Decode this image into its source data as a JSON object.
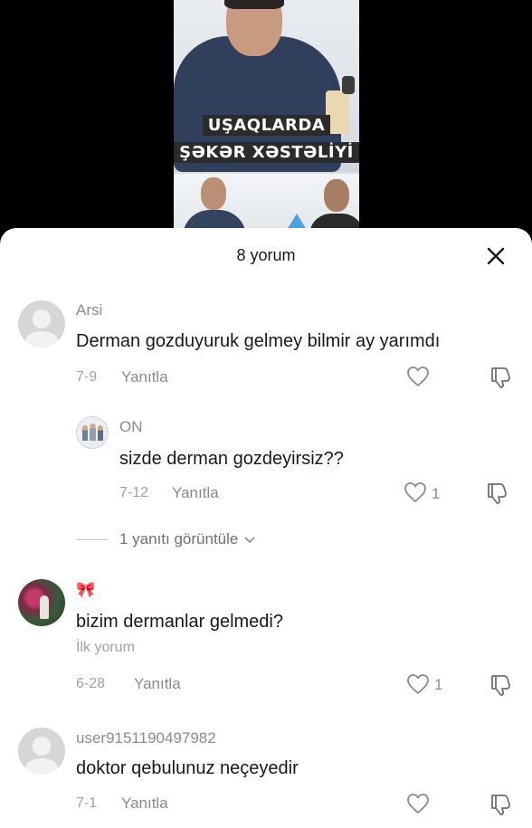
{
  "video": {
    "caption_line1": "UŞAQLARDA",
    "caption_line2": "ŞƏKƏR XƏSTƏLİYİ"
  },
  "sheet": {
    "title": "8 yorum",
    "close_icon": "close-icon"
  },
  "comments": [
    {
      "username": "Arsi",
      "text": "Derman gozduyuruk gelmey bilmir ay yarımdı",
      "date": "7-9",
      "reply_label": "Yanıtla",
      "likes": ""
    },
    {
      "username": "ON",
      "text": "sizde derman gozdeyirsiz??",
      "date": "7-12",
      "reply_label": "Yanıtla",
      "likes": "1"
    },
    {
      "username": "🎀",
      "text": "bizim dermanlar gelmedi?",
      "badge": "İlk yorum",
      "date": "6-28",
      "reply_label": "Yanıtla",
      "likes": "1"
    },
    {
      "username": "user9151190497982",
      "text": "doktor qebulunuz neçeyedir",
      "date": "7-1",
      "reply_label": "Yanıtla",
      "likes": ""
    }
  ],
  "view_replies": "1 yanıtı görüntüle",
  "colors": {
    "text_primary": "#161823",
    "text_secondary": "#8a8b91"
  }
}
